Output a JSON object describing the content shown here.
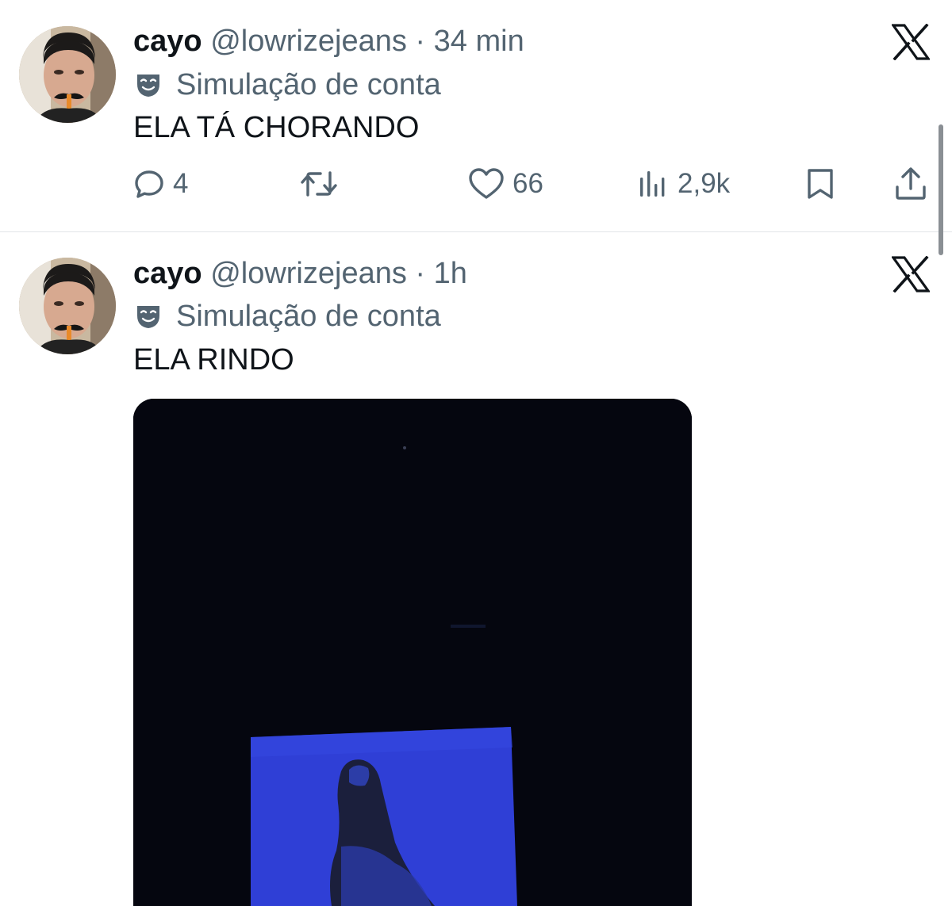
{
  "tweets": [
    {
      "name": "cayo",
      "handle": "@lowrizejeans",
      "separator": "·",
      "time": "34 min",
      "label": "Simulação de conta",
      "text": "ELA TÁ CHORANDO",
      "metrics": {
        "replies": "4",
        "likes": "66",
        "views": "2,9k"
      }
    },
    {
      "name": "cayo",
      "handle": "@lowrizejeans",
      "separator": "·",
      "time": "1h",
      "label": "Simulação de conta",
      "text": "ELA RINDO"
    }
  ],
  "icons": {
    "label": "theater-masks-icon",
    "platform": "x-logo-icon",
    "reply": "reply-icon",
    "retweet": "retweet-icon",
    "like": "heart-icon",
    "views": "views-chart-icon",
    "bookmark": "bookmark-icon",
    "share": "share-icon"
  },
  "colors": {
    "text_primary": "#0f1419",
    "text_secondary": "#536471",
    "divider": "#e1e4e8",
    "media_background": "#03040a",
    "media_screen": "#2f3fd6"
  }
}
